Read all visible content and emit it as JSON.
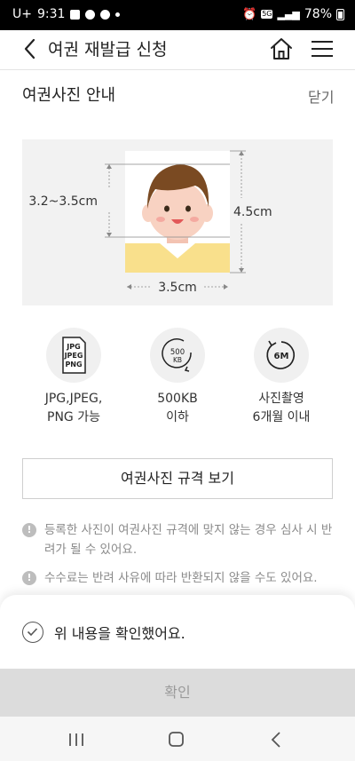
{
  "status_bar": {
    "carrier": "U+",
    "time": "9:31",
    "network": "5G",
    "battery": "78%"
  },
  "header": {
    "title": "여권 재발급 신청"
  },
  "section": {
    "title": "여권사진 안내",
    "close_label": "닫기"
  },
  "photo_guide": {
    "face_height": "3.2~3.5cm",
    "photo_height": "4.5cm",
    "photo_width": "3.5cm",
    "colors": {
      "skin": "#f8d2c2",
      "hair": "#7a4a22",
      "shirt": "#f9e08c",
      "mouth": "#e25858",
      "panel": "#f2f2f2"
    }
  },
  "specs": [
    {
      "icon": "file-format-icon",
      "icon_text": [
        "JPG",
        "JPEG",
        "PNG"
      ],
      "line1": "JPG,JPEG,",
      "line2": "PNG 가능"
    },
    {
      "icon": "file-size-icon",
      "icon_text": [
        "500",
        "KB"
      ],
      "line1": "500KB",
      "line2": "이하"
    },
    {
      "icon": "six-months-icon",
      "icon_text": [
        "6M"
      ],
      "line1": "사진촬영",
      "line2": "6개월 이내"
    }
  ],
  "spec_button_label": "여권사진 규격 보기",
  "notices": [
    "등록한 사진이 여권사진 규격에 맞지 않는 경우 심사 시 반려가 될 수 있어요.",
    "수수료는 반려 사유에 따라 반환되지 않을 수도 있어요."
  ],
  "confirm_check_label": "위 내용을 확인했어요.",
  "confirm_button_label": "확인",
  "nav": {
    "recents": "|||",
    "home": "○",
    "back": "‹"
  }
}
